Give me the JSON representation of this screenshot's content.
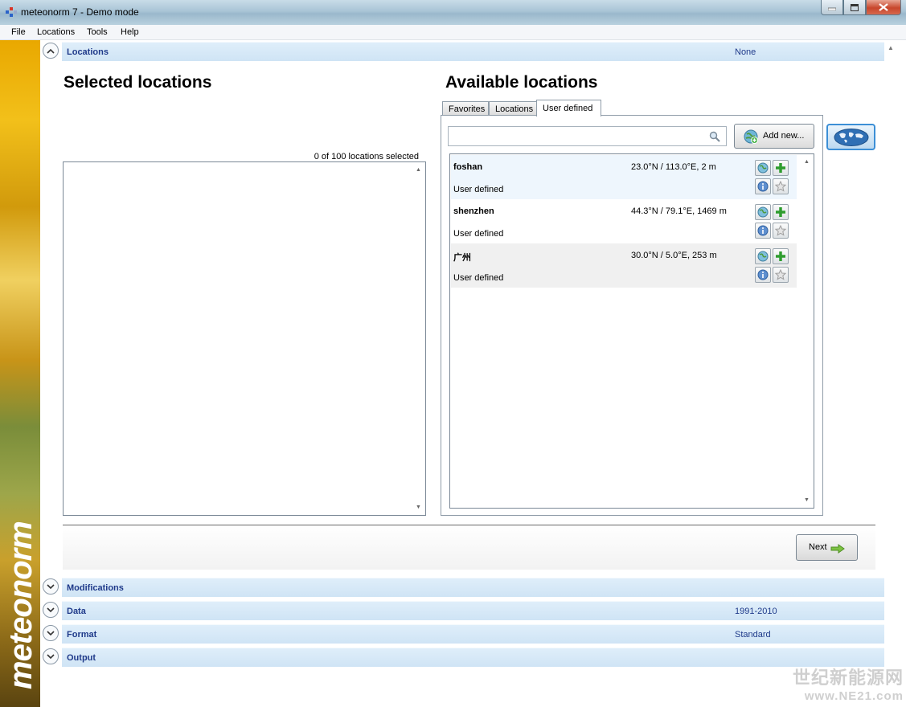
{
  "window": {
    "title": "meteonorm 7 - Demo mode"
  },
  "menu": [
    "File",
    "Locations",
    "Tools",
    "Help"
  ],
  "brand": {
    "logo": "meteonorm"
  },
  "sections": {
    "locations": {
      "label": "Locations",
      "value": "None"
    },
    "modifications": {
      "label": "Modifications",
      "value": ""
    },
    "data": {
      "label": "Data",
      "value": "1991-2010"
    },
    "format": {
      "label": "Format",
      "value": "Standard"
    },
    "output": {
      "label": "Output",
      "value": ""
    }
  },
  "selected": {
    "heading": "Selected locations",
    "count": "0  of  100  locations selected"
  },
  "available": {
    "heading": "Available locations",
    "tabs": [
      "Favorites",
      "Locations",
      "User defined"
    ],
    "active_tab": "User defined",
    "search_value": "",
    "add_new_label": "Add new...",
    "items": [
      {
        "name": "foshan",
        "coords": "23.0°N / 113.0°E, 2 m",
        "type": "User defined"
      },
      {
        "name": "shenzhen",
        "coords": "44.3°N / 79.1°E, 1469 m",
        "type": "User defined"
      },
      {
        "name": "广州",
        "coords": "30.0°N / 5.0°E, 253 m",
        "type": "User defined"
      }
    ]
  },
  "buttons": {
    "next": "Next"
  },
  "watermark": {
    "line1": "世纪新能源网",
    "line2": "www.NE21.com"
  },
  "colors": {
    "section_bar": "#d6e9f8",
    "section_text": "#1f3a8a",
    "row_highlight": "#eef6fd",
    "row_alt": "#f0f0f0"
  }
}
